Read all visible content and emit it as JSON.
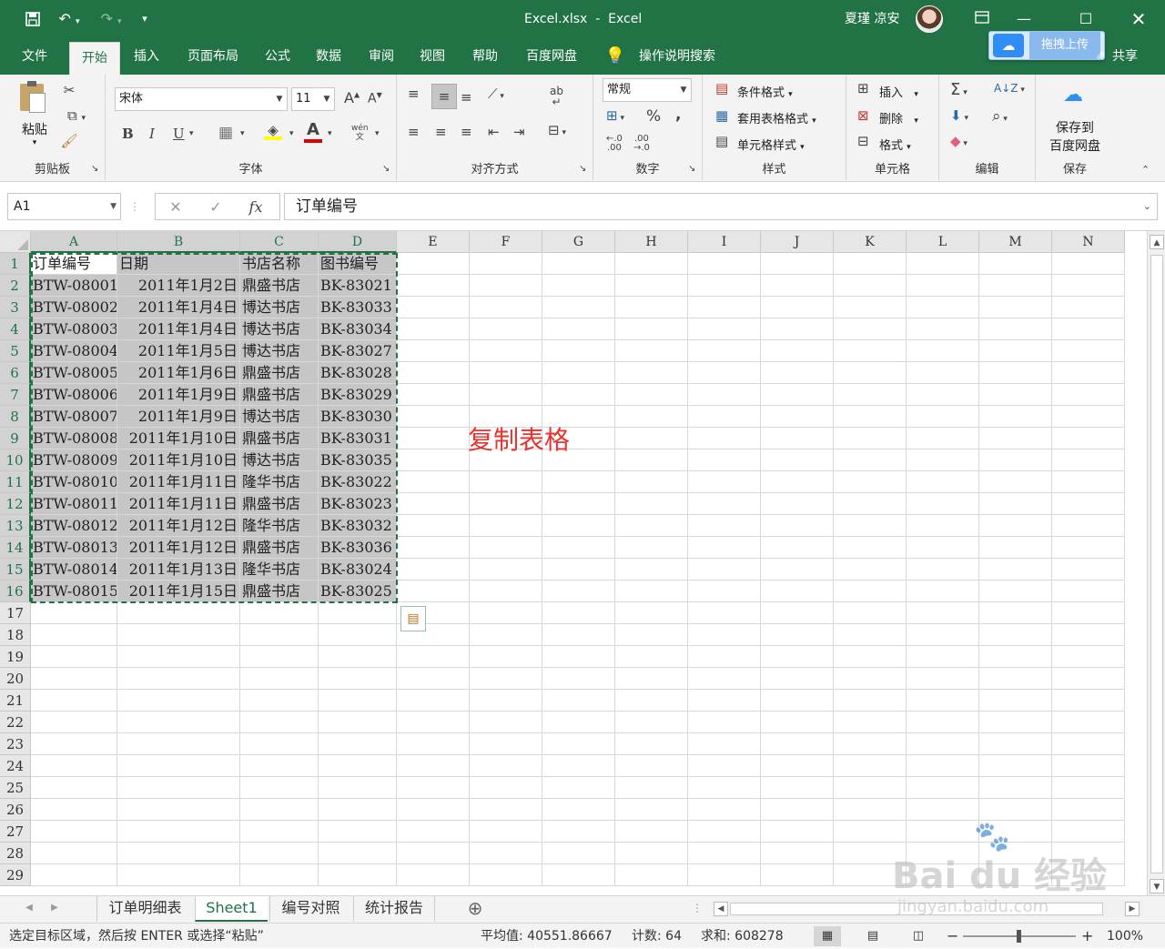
{
  "title": {
    "file": "Excel.xlsx",
    "sep": "-",
    "app": "Excel",
    "user": "夏瑾 凉安",
    "upload_btn": "拖拽上传",
    "share": "共享"
  },
  "tabs": [
    "文件",
    "开始",
    "插入",
    "页面布局",
    "公式",
    "数据",
    "审阅",
    "视图",
    "帮助",
    "百度网盘"
  ],
  "tell_me": "操作说明搜索",
  "ribbon": {
    "clipboard": {
      "paste": "粘贴",
      "label": "剪贴板"
    },
    "font": {
      "name": "宋体",
      "size": "11",
      "label": "字体",
      "bold": "B",
      "italic": "I",
      "underline": "U",
      "font_color": "A",
      "increase": "A",
      "decrease": "A",
      "wen": "wén"
    },
    "align": {
      "label": "对齐方式"
    },
    "number": {
      "format": "常规",
      "pct": "%",
      "comma": ",",
      "label": "数字"
    },
    "styles": {
      "cond": "条件格式",
      "table": "套用表格格式",
      "cell": "单元格样式",
      "label": "样式"
    },
    "cells": {
      "insert": "插入",
      "delete": "删除",
      "format": "格式",
      "label": "单元格"
    },
    "editing": {
      "label": "编辑"
    },
    "save": {
      "line1": "保存到",
      "line2": "百度网盘",
      "label": "保存"
    }
  },
  "formula": {
    "name_box": "A1",
    "content": "订单编号",
    "fx": "fx"
  },
  "columns": [
    "A",
    "B",
    "C",
    "D",
    "E",
    "F",
    "G",
    "H",
    "I",
    "J",
    "K",
    "L",
    "M",
    "N"
  ],
  "rows": [
    "1",
    "2",
    "3",
    "4",
    "5",
    "6",
    "7",
    "8",
    "9",
    "10",
    "11",
    "12",
    "13",
    "14",
    "15",
    "16",
    "17",
    "18",
    "19",
    "20",
    "21",
    "22",
    "23",
    "24",
    "25",
    "26",
    "27",
    "28",
    "29"
  ],
  "table": {
    "header": [
      "订单编号",
      "日期",
      "书店名称",
      "图书编号"
    ],
    "data": [
      [
        "BTW-08001",
        "2011年1月2日",
        "鼎盛书店",
        "BK-83021"
      ],
      [
        "BTW-08002",
        "2011年1月4日",
        "博达书店",
        "BK-83033"
      ],
      [
        "BTW-08003",
        "2011年1月4日",
        "博达书店",
        "BK-83034"
      ],
      [
        "BTW-08004",
        "2011年1月5日",
        "博达书店",
        "BK-83027"
      ],
      [
        "BTW-08005",
        "2011年1月6日",
        "鼎盛书店",
        "BK-83028"
      ],
      [
        "BTW-08006",
        "2011年1月9日",
        "鼎盛书店",
        "BK-83029"
      ],
      [
        "BTW-08007",
        "2011年1月9日",
        "博达书店",
        "BK-83030"
      ],
      [
        "BTW-08008",
        "2011年1月10日",
        "鼎盛书店",
        "BK-83031"
      ],
      [
        "BTW-08009",
        "2011年1月10日",
        "博达书店",
        "BK-83035"
      ],
      [
        "BTW-08010",
        "2011年1月11日",
        "隆华书店",
        "BK-83022"
      ],
      [
        "BTW-08011",
        "2011年1月11日",
        "鼎盛书店",
        "BK-83023"
      ],
      [
        "BTW-08012",
        "2011年1月12日",
        "隆华书店",
        "BK-83032"
      ],
      [
        "BTW-08013",
        "2011年1月12日",
        "鼎盛书店",
        "BK-83036"
      ],
      [
        "BTW-08014",
        "2011年1月13日",
        "隆华书店",
        "BK-83024"
      ],
      [
        "BTW-08015",
        "2011年1月15日",
        "鼎盛书店",
        "BK-83025"
      ]
    ]
  },
  "annotation": "复制表格",
  "sheets": [
    "订单明细表",
    "Sheet1",
    "编号对照",
    "统计报告"
  ],
  "status": {
    "message": "选定目标区域，然后按 ENTER 或选择“粘贴”",
    "average": "平均值: 40551.86667",
    "count": "计数: 64",
    "sum": "求和: 608278",
    "zoom": "100%"
  },
  "watermark": {
    "brand": "Bai du 经验",
    "url": "jingyan.baidu.com"
  },
  "colors": {
    "excel_green": "#217346",
    "selection_fill": "#c6c6c6",
    "annotation_red": "#e8322d"
  }
}
